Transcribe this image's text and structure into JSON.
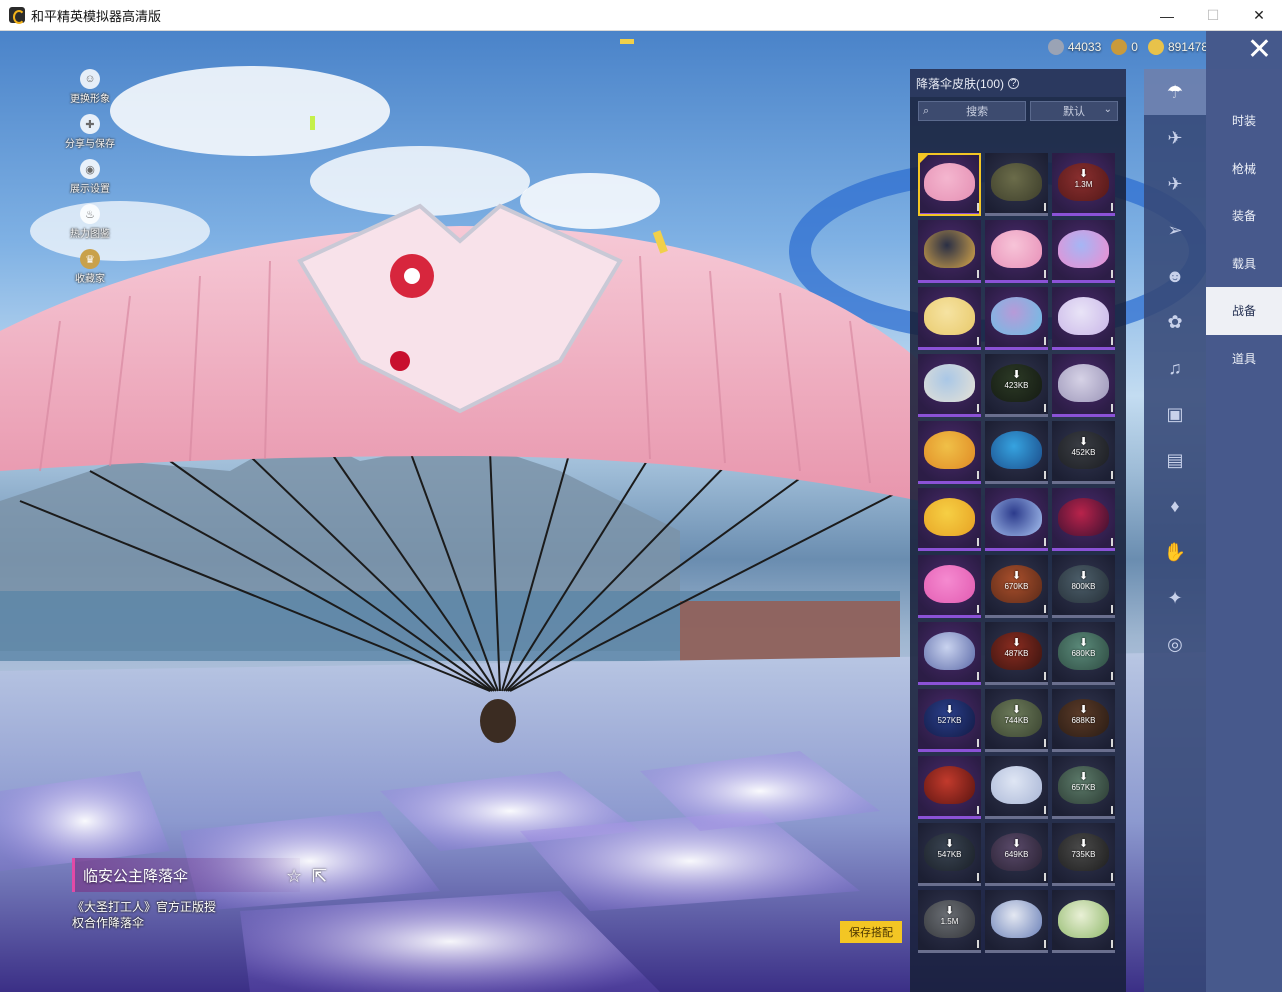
{
  "window": {
    "title": "和平精英模拟器高清版",
    "controls": [
      "—",
      "☐",
      "✕"
    ]
  },
  "currency": [
    {
      "icon": "silver-coin-icon",
      "value": "44033",
      "color": "#9aa3b5"
    },
    {
      "icon": "gold-token-icon",
      "value": "0",
      "color": "#c99a3c"
    },
    {
      "icon": "gold-coin-icon",
      "value": "891478",
      "color": "#e8c24a"
    }
  ],
  "close_icon": "✕",
  "left_tools": [
    {
      "icon": "person-icon",
      "glyph": "☺",
      "label": "更换形象"
    },
    {
      "icon": "share-code-icon",
      "glyph": "✚",
      "label": "分享与保存"
    },
    {
      "icon": "eye-icon",
      "glyph": "◉",
      "label": "展示设置"
    },
    {
      "icon": "flame-icon",
      "glyph": "♨",
      "label": "热力图鉴"
    },
    {
      "icon": "badge-icon",
      "glyph": "♛",
      "label": "收藏家"
    }
  ],
  "item": {
    "name": "临安公主降落伞",
    "description": "《大圣打工人》官方正版授权合作降落伞",
    "fav_icon": "☆",
    "share_icon": "⇱"
  },
  "save_button": "保存搭配",
  "panel": {
    "title": "降落伞皮肤(100)",
    "help": "?",
    "search_placeholder": "搜索",
    "sort_value": "默认",
    "sort_chevron": "⌄",
    "search_glyph": "⌕"
  },
  "skins": [
    {
      "bg": "purple",
      "c1": "#f4b6cf",
      "c2": "#e58fb3",
      "selected": true
    },
    {
      "bg": "dark",
      "c1": "#6b6c4a",
      "c2": "#3d3e2b"
    },
    {
      "bg": "purple",
      "c1": "#8a2f2f",
      "c2": "#531818",
      "size": "1.3M"
    },
    {
      "bg": "purple",
      "c1": "#2a2f45",
      "c2": "#d9a84a"
    },
    {
      "bg": "purple",
      "c1": "#f7c4d8",
      "c2": "#e890b8"
    },
    {
      "bg": "purple",
      "c1": "#a5b6f5",
      "c2": "#f08ccf"
    },
    {
      "bg": "purple",
      "c1": "#f6e3a2",
      "c2": "#e8c96a"
    },
    {
      "bg": "purple",
      "c1": "#b79ad8",
      "c2": "#6bc0e6"
    },
    {
      "bg": "purple",
      "c1": "#e9e4f7",
      "c2": "#c9b6e8"
    },
    {
      "bg": "purple",
      "c1": "#a9c7e6",
      "c2": "#e7e2d6"
    },
    {
      "bg": "dark",
      "c1": "#2c3a26",
      "c2": "#141a12",
      "size": "423KB"
    },
    {
      "bg": "purple",
      "c1": "#d6d2e6",
      "c2": "#9b95b8"
    },
    {
      "bg": "purple",
      "c1": "#f0c048",
      "c2": "#e08a24"
    },
    {
      "bg": "dark",
      "c1": "#36a3e0",
      "c2": "#1b4c8a"
    },
    {
      "bg": "dark",
      "c1": "#3a3d44",
      "c2": "#1c1e22",
      "size": "452KB"
    },
    {
      "bg": "purple",
      "c1": "#f6cf44",
      "c2": "#e7a223"
    },
    {
      "bg": "purple",
      "c1": "#2c3b8c",
      "c2": "#a9c4f2"
    },
    {
      "bg": "purple",
      "c1": "#b9234b",
      "c2": "#3a1030"
    },
    {
      "bg": "purple",
      "c1": "#f58ad0",
      "c2": "#e25bb1"
    },
    {
      "bg": "dark",
      "c1": "#a94f2c",
      "c2": "#5b2a18",
      "size": "670KB"
    },
    {
      "bg": "dark",
      "c1": "#4c5e6a",
      "c2": "#263038",
      "size": "800KB"
    },
    {
      "bg": "purple",
      "c1": "#c9d3ef",
      "c2": "#5c6aa8"
    },
    {
      "bg": "dark",
      "c1": "#8a2c20",
      "c2": "#3a1410",
      "size": "487KB"
    },
    {
      "bg": "dark",
      "c1": "#5b8a7a",
      "c2": "#2e4c42",
      "size": "680KB"
    },
    {
      "bg": "purple",
      "c1": "#2a3f8a",
      "c2": "#121a44",
      "size": "527KB"
    },
    {
      "bg": "dark",
      "c1": "#6c7a5a",
      "c2": "#3a4430",
      "size": "744KB"
    },
    {
      "bg": "dark",
      "c1": "#5a3a28",
      "c2": "#2a1c14",
      "size": "688KB"
    },
    {
      "bg": "purple",
      "c1": "#c23a2c",
      "c2": "#5a1410"
    },
    {
      "bg": "dark",
      "c1": "#dfe6f4",
      "c2": "#a9b6d6"
    },
    {
      "bg": "dark",
      "c1": "#5c7a6a",
      "c2": "#2c3c34",
      "size": "657KB"
    },
    {
      "bg": "dark",
      "c1": "#3a4452",
      "c2": "#1a2028",
      "size": "547KB"
    },
    {
      "bg": "dark",
      "c1": "#5a4a6a",
      "c2": "#2a2234",
      "size": "649KB"
    },
    {
      "bg": "dark",
      "c1": "#4a4a4a",
      "c2": "#1e1e1e",
      "size": "735KB"
    },
    {
      "bg": "dark",
      "c1": "#6a6e74",
      "c2": "#34363a",
      "size": "1.5M"
    },
    {
      "bg": "dark",
      "c1": "#e4e8f2",
      "c2": "#6a80b8"
    },
    {
      "bg": "dark",
      "c1": "#e9f0d6",
      "c2": "#8fb86a"
    }
  ],
  "download_glyph": "⬇",
  "rail_icons": [
    {
      "name": "parachute-icon",
      "glyph": "☂",
      "active": true
    },
    {
      "name": "glider-icon",
      "glyph": "✈"
    },
    {
      "name": "plane-icon",
      "glyph": "✈"
    },
    {
      "name": "jet-icon",
      "glyph": "➢"
    },
    {
      "name": "emote-icon",
      "glyph": "☻"
    },
    {
      "name": "companion-icon",
      "glyph": "✿"
    },
    {
      "name": "sound-icon",
      "glyph": "♫"
    },
    {
      "name": "card-icon",
      "glyph": "▣"
    },
    {
      "name": "photo-icon",
      "glyph": "▤"
    },
    {
      "name": "extinguisher-icon",
      "glyph": "♦"
    },
    {
      "name": "hand-icon",
      "glyph": "✋"
    },
    {
      "name": "wand-icon",
      "glyph": "✦"
    },
    {
      "name": "planet-icon",
      "glyph": "◎"
    }
  ],
  "categories": [
    {
      "label": "时装"
    },
    {
      "label": "枪械"
    },
    {
      "label": "装备"
    },
    {
      "label": "载具"
    },
    {
      "label": "战备",
      "active": true
    },
    {
      "label": "道具"
    }
  ]
}
